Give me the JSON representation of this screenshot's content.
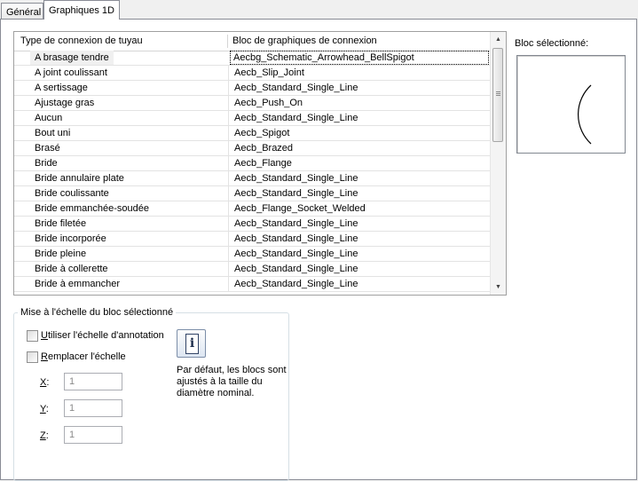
{
  "tabs": [
    {
      "label": "Général"
    },
    {
      "label": "Graphiques 1D"
    }
  ],
  "grid": {
    "columns": [
      "Type de connexion de tuyau",
      "Bloc de graphiques de connexion"
    ],
    "rows": [
      {
        "type": "A brasage tendre",
        "block": "Aecbg_Schematic_Arrowhead_BellSpigot"
      },
      {
        "type": "A joint coulissant",
        "block": "Aecb_Slip_Joint"
      },
      {
        "type": "A sertissage",
        "block": "Aecb_Standard_Single_Line"
      },
      {
        "type": "Ajustage gras",
        "block": "Aecb_Push_On"
      },
      {
        "type": "Aucun",
        "block": "Aecb_Standard_Single_Line"
      },
      {
        "type": "Bout uni",
        "block": "Aecb_Spigot"
      },
      {
        "type": "Brasé",
        "block": "Aecb_Brazed"
      },
      {
        "type": "Bride",
        "block": "Aecb_Flange"
      },
      {
        "type": "Bride annulaire plate",
        "block": "Aecb_Standard_Single_Line"
      },
      {
        "type": "Bride coulissante",
        "block": "Aecb_Standard_Single_Line"
      },
      {
        "type": "Bride emmanchée-soudée",
        "block": "Aecb_Flange_Socket_Welded"
      },
      {
        "type": "Bride filetée",
        "block": "Aecb_Standard_Single_Line"
      },
      {
        "type": "Bride incorporée",
        "block": "Aecb_Standard_Single_Line"
      },
      {
        "type": "Bride pleine",
        "block": "Aecb_Standard_Single_Line"
      },
      {
        "type": "Bride à collerette",
        "block": "Aecb_Standard_Single_Line"
      },
      {
        "type": "Bride à emmancher",
        "block": "Aecb_Standard_Single_Line"
      }
    ]
  },
  "preview": {
    "label": "Bloc sélectionné:"
  },
  "scale_group": {
    "title": "Mise à l'échelle du bloc sélectionné",
    "use_annotation": {
      "label_hotkey": "U",
      "label_rest": "tiliser l'échelle d'annotation",
      "checked": false
    },
    "override": {
      "label_hotkey": "R",
      "label_rest": "emplacer l'échelle",
      "checked": false
    },
    "x": {
      "label": "X",
      "suffix": ":",
      "value": "1"
    },
    "y": {
      "label": "Y",
      "suffix": ":",
      "value": "1"
    },
    "z": {
      "label": "Z",
      "suffix": ":",
      "value": "1"
    },
    "info_text": "Par défaut, les blocs sont ajustés à la taille du diamètre nominal."
  },
  "icons": {
    "info": "info-icon",
    "scroll_up": "scroll-up-arrow-icon",
    "scroll_down": "scroll-down-arrow-icon"
  }
}
